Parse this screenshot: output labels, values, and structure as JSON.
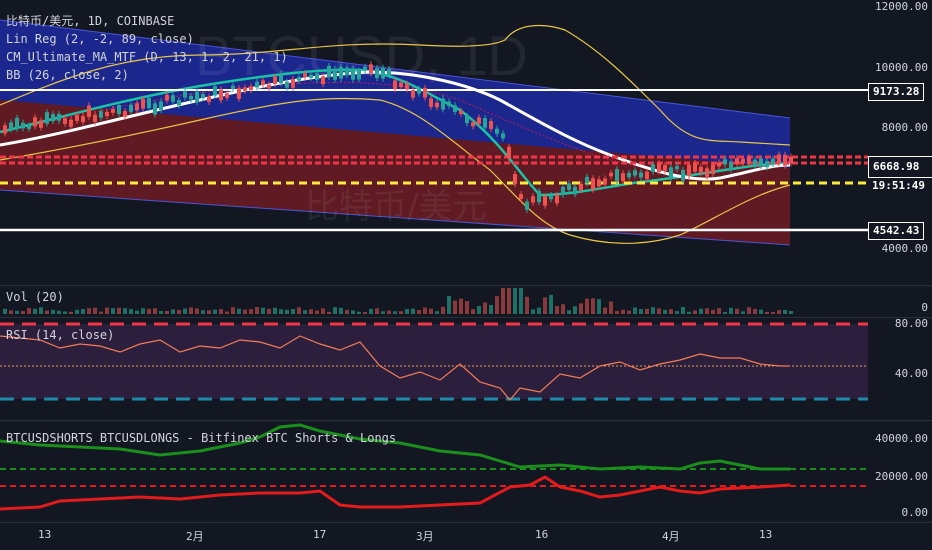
{
  "main": {
    "symbol_line": "比特币/美元, 1D, COINBASE",
    "indicators": [
      "Lin Reg (2, -2, 89, close)",
      "CM_Ultimate_MA_MTF (D, 13, 1, 2, 21, 1)",
      "BB (26, close, 2)"
    ],
    "watermark": "BTCUSD, 1D",
    "watermark_sub": "比特币/美元",
    "price_ticks": [
      "12000.00",
      "10000.00",
      "8000.00",
      "4000.00"
    ],
    "tags": {
      "level_high": "9173.28",
      "last_price": "6668.98",
      "countdown": "19:51:49",
      "level_low": "4542.43"
    }
  },
  "volume": {
    "label": "Vol (20)",
    "tick": "0"
  },
  "rsi": {
    "label": "RSI (14, close)",
    "ticks": [
      "80.00",
      "40.00"
    ]
  },
  "shorts_longs": {
    "label": "BTCUSDSHORTS BTCUSDLONGS - Bitfinex BTC Shorts & Longs",
    "ticks": [
      "40000.00",
      "20000.00",
      "0.00"
    ]
  },
  "time_axis": [
    "13",
    "2月",
    "17",
    "3月",
    "16",
    "4月",
    "13"
  ],
  "colors": {
    "background": "#131722",
    "up": "#26a69a",
    "down": "#ef5350",
    "level_line": "#ffffff",
    "dashed_red": "#f23645",
    "dashed_yellow": "#ffeb3b",
    "rsi": "#f57c55",
    "longs": "#1b8f1b",
    "shorts": "#e31b1b"
  }
}
